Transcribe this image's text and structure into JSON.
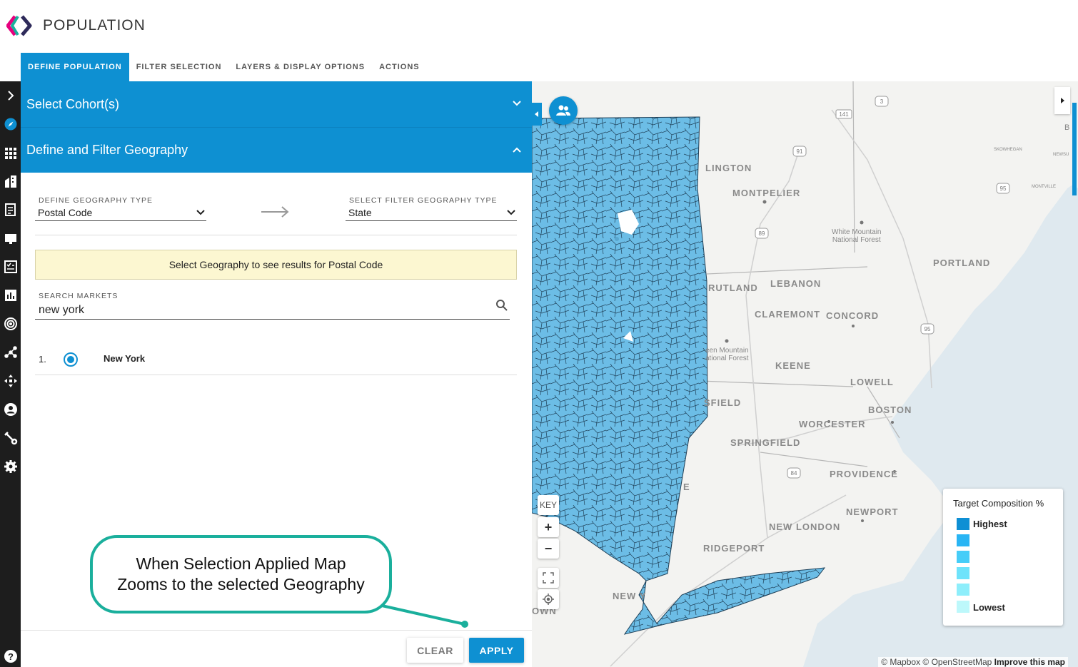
{
  "app": {
    "title": "POPULATION"
  },
  "tabs": [
    {
      "label": "DEFINE POPULATION",
      "active": true
    },
    {
      "label": "FILTER SELECTION",
      "active": false
    },
    {
      "label": "LAYERS & DISPLAY OPTIONS",
      "active": false
    },
    {
      "label": "ACTIONS",
      "active": false
    }
  ],
  "rail": {
    "icons": [
      "chevron-right-icon",
      "compass-icon",
      "grid-icon",
      "building-icon",
      "report-icon",
      "monitor-icon",
      "checklist-icon",
      "bar-chart-icon",
      "target-icon",
      "network-icon",
      "move-icon",
      "user-icon",
      "wrench-icon",
      "gear-icon",
      "help-icon"
    ]
  },
  "panel": {
    "cohort_header": "Select Cohort(s)",
    "geo_header": "Define and Filter Geography",
    "define_type_label": "DEFINE GEOGRAPHY TYPE",
    "define_type_value": "Postal Code",
    "filter_type_label": "SELECT FILTER GEOGRAPHY TYPE",
    "filter_type_value": "State",
    "notice": "Select Geography to see results for Postal Code",
    "search_label": "SEARCH MARKETS",
    "search_value": "new york",
    "results": [
      {
        "num": "1.",
        "name": "New York",
        "selected": true
      }
    ],
    "clear_label": "CLEAR",
    "apply_label": "APPLY"
  },
  "callout": {
    "line1": "When Selection Applied Map",
    "line2": "Zooms to the selected Geography"
  },
  "map": {
    "cities": [
      "LINGTON",
      "MONTPELIER",
      "RUTLAND",
      "LEBANON",
      "CLAREMONT",
      "CONCORD",
      "PORTLAND",
      "KEENE",
      "LOWELL",
      "BOSTON",
      "SFIELD",
      "WORCESTER",
      "SPRINGFIELD",
      "PROVIDENCE",
      "NEWPORT",
      "NEW LONDON",
      "RIDGEPORT",
      "NEW Y",
      "OWN",
      "E"
    ],
    "forest_1": [
      "White Mountain",
      "National Forest"
    ],
    "forest_2": [
      "een Mountain",
      "ational Forest"
    ],
    "small_labels": [
      "SKOWHEGAN",
      "NEWSU",
      "MONTVILLE",
      "B"
    ],
    "route_shields": [
      "91",
      "89",
      "95",
      "95",
      "84",
      "3",
      "141"
    ],
    "key_label": "KEY",
    "zoom_in": "+",
    "zoom_out": "−",
    "legend": {
      "title": "Target Composition %",
      "highest": "Highest",
      "lowest": "Lowest",
      "colors": [
        "#0e8fd4",
        "#29b5f4",
        "#46cdf8",
        "#6ee3fb",
        "#8eeefb",
        "#bdf8fb"
      ]
    },
    "attribution_prefix": "© Mapbox © OpenStreetMap ",
    "attribution_link": "Improve this map",
    "fill_color": "#6cbde6",
    "water_color": "#dfe9ef"
  },
  "colors": {
    "accent": "#0e90d2",
    "callout": "#1aaf9c",
    "rail": "#1d1d1d"
  }
}
